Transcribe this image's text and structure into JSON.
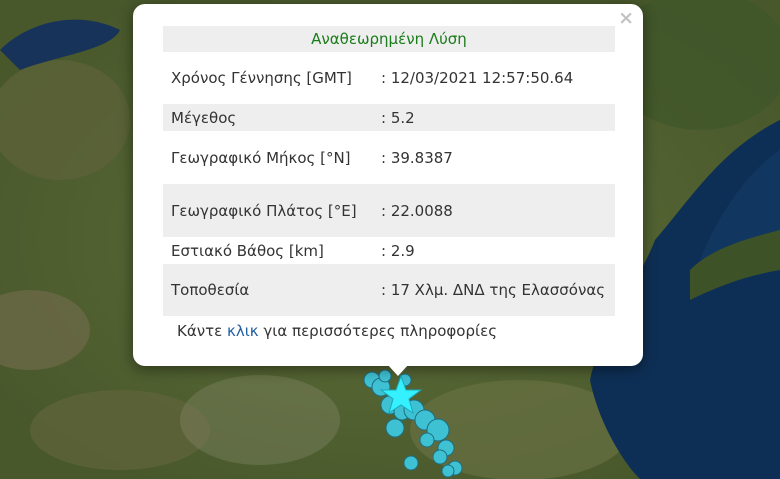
{
  "popup": {
    "title": "Αναθεωρημένη Λύση",
    "close_icon": "close-icon",
    "rows": [
      {
        "label": "Χρόνος Γέννησης [GMT]",
        "value": ": 12/03/2021 12:57:50.64"
      },
      {
        "label": "Μέγεθος",
        "value": ": 5.2"
      },
      {
        "label": "Γεωγραφικό Μήκος [°N]",
        "value": ": 39.8387"
      },
      {
        "label": "Γεωγραφικό Πλάτος [°E]",
        "value": ": 22.0088"
      },
      {
        "label": "Εστιακό Βάθος [km]",
        "value": ": 2.9"
      },
      {
        "label": "Τοποθεσία",
        "value": ": 17 Χλμ. ΔΝΔ της Ελασσόνας"
      }
    ],
    "footer_prefix": "Κάντε ",
    "footer_link": "κλικ",
    "footer_suffix": " για περισσότερες πληροφορίες"
  },
  "map": {
    "epicenter_icon": "star-icon",
    "colors": {
      "land": "#4a5a2c",
      "sea": "#0e2f55",
      "marker": "#3fc1d4",
      "star": "#35f0ff",
      "title_green": "#1a7c1a"
    }
  }
}
